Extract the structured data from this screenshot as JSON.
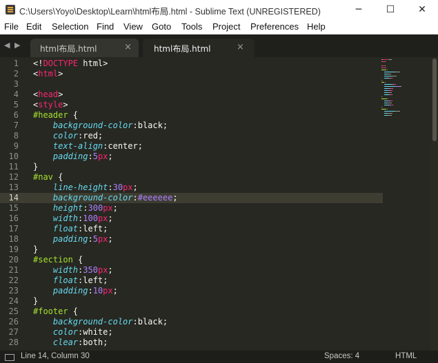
{
  "window": {
    "title": "C:\\Users\\Yoyo\\Desktop\\Learn\\html布局.html - Sublime Text (UNREGISTERED)",
    "minimize": "─",
    "maximize": "☐",
    "close": "✕"
  },
  "menu": [
    "File",
    "Edit",
    "Selection",
    "Find",
    "View",
    "Goto",
    "Tools",
    "Project",
    "Preferences",
    "Help"
  ],
  "tabs": {
    "nav_prev": "◀",
    "nav_next": "▶",
    "items": [
      {
        "label": "html布局.html",
        "active": false,
        "close": "×"
      },
      {
        "label": "html布局.html",
        "active": true,
        "close": "×"
      }
    ]
  },
  "editor": {
    "current_line": 14,
    "lines": [
      [
        [
          "pun",
          "<!"
        ],
        [
          "tag",
          "DOCTYPE"
        ],
        [
          "pun",
          " html>"
        ]
      ],
      [
        [
          "pun",
          "<"
        ],
        [
          "tag",
          "html"
        ],
        [
          "pun",
          ">"
        ]
      ],
      [],
      [
        [
          "pun",
          "<"
        ],
        [
          "tag",
          "head"
        ],
        [
          "pun",
          ">"
        ]
      ],
      [
        [
          "pun",
          "<"
        ],
        [
          "tag",
          "style"
        ],
        [
          "pun",
          ">"
        ]
      ],
      [
        [
          "sel",
          "#header"
        ],
        [
          "pun",
          " {"
        ]
      ],
      [
        [
          "pun",
          "    "
        ],
        [
          "prop",
          "background-color"
        ],
        [
          "pun",
          ":black;"
        ]
      ],
      [
        [
          "pun",
          "    "
        ],
        [
          "prop",
          "color"
        ],
        [
          "pun",
          ":red;"
        ]
      ],
      [
        [
          "pun",
          "    "
        ],
        [
          "prop",
          "text-align"
        ],
        [
          "pun",
          ":center;"
        ]
      ],
      [
        [
          "pun",
          "    "
        ],
        [
          "prop",
          "padding"
        ],
        [
          "pun",
          ":"
        ],
        [
          "num",
          "5"
        ],
        [
          "unit",
          "px"
        ],
        [
          "pun",
          ";"
        ]
      ],
      [
        [
          "pun",
          "}"
        ]
      ],
      [
        [
          "sel",
          "#nav"
        ],
        [
          "pun",
          " {"
        ]
      ],
      [
        [
          "pun",
          "    "
        ],
        [
          "prop",
          "line-height"
        ],
        [
          "pun",
          ":"
        ],
        [
          "num",
          "30"
        ],
        [
          "unit",
          "px"
        ],
        [
          "pun",
          ";"
        ]
      ],
      [
        [
          "pun",
          "    "
        ],
        [
          "prop",
          "background-color"
        ],
        [
          "pun",
          ":"
        ],
        [
          "num",
          "#eeeeee"
        ],
        [
          "pun",
          ";"
        ]
      ],
      [
        [
          "pun",
          "    "
        ],
        [
          "prop",
          "height"
        ],
        [
          "pun",
          ":"
        ],
        [
          "num",
          "300"
        ],
        [
          "unit",
          "px"
        ],
        [
          "pun",
          ";"
        ]
      ],
      [
        [
          "pun",
          "    "
        ],
        [
          "prop",
          "width"
        ],
        [
          "pun",
          ":"
        ],
        [
          "num",
          "100"
        ],
        [
          "unit",
          "px"
        ],
        [
          "pun",
          ";"
        ]
      ],
      [
        [
          "pun",
          "    "
        ],
        [
          "prop",
          "float"
        ],
        [
          "pun",
          ":left;"
        ]
      ],
      [
        [
          "pun",
          "    "
        ],
        [
          "prop",
          "padding"
        ],
        [
          "pun",
          ":"
        ],
        [
          "num",
          "5"
        ],
        [
          "unit",
          "px"
        ],
        [
          "pun",
          ";"
        ]
      ],
      [
        [
          "pun",
          "}"
        ]
      ],
      [
        [
          "sel",
          "#section"
        ],
        [
          "pun",
          " {"
        ]
      ],
      [
        [
          "pun",
          "    "
        ],
        [
          "prop",
          "width"
        ],
        [
          "pun",
          ":"
        ],
        [
          "num",
          "350"
        ],
        [
          "unit",
          "px"
        ],
        [
          "pun",
          ";"
        ]
      ],
      [
        [
          "pun",
          "    "
        ],
        [
          "prop",
          "float"
        ],
        [
          "pun",
          ":left;"
        ]
      ],
      [
        [
          "pun",
          "    "
        ],
        [
          "prop",
          "padding"
        ],
        [
          "pun",
          ":"
        ],
        [
          "num",
          "10"
        ],
        [
          "unit",
          "px"
        ],
        [
          "pun",
          ";"
        ]
      ],
      [
        [
          "pun",
          "}"
        ]
      ],
      [
        [
          "sel",
          "#footer"
        ],
        [
          "pun",
          " {"
        ]
      ],
      [
        [
          "pun",
          "    "
        ],
        [
          "prop",
          "background-color"
        ],
        [
          "pun",
          ":black;"
        ]
      ],
      [
        [
          "pun",
          "    "
        ],
        [
          "prop",
          "color"
        ],
        [
          "pun",
          ":white;"
        ]
      ],
      [
        [
          "pun",
          "    "
        ],
        [
          "prop",
          "clear"
        ],
        [
          "pun",
          ":both;"
        ]
      ]
    ]
  },
  "status": {
    "position": "Line 14, Column 30",
    "spaces": "Spaces: 4",
    "syntax": "HTML"
  },
  "colors": {
    "background": "#272822",
    "tag": "#f92672",
    "selector": "#a6e22e",
    "property": "#66d9ef",
    "number": "#ae81ff",
    "text": "#f8f8f2"
  }
}
